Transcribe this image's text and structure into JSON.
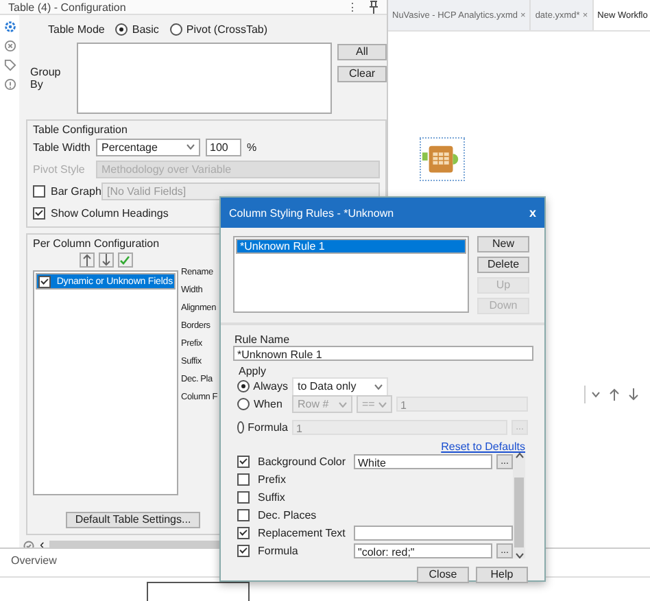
{
  "config_panel": {
    "title": "Table (4) - Configuration",
    "menu": "⋮",
    "table_mode": {
      "label": "Table Mode",
      "options": [
        {
          "label": "Basic",
          "selected": true
        },
        {
          "label": "Pivot (CrossTab)",
          "selected": false
        }
      ]
    },
    "group_by": {
      "label": "Group By",
      "buttons": [
        "All",
        "Clear"
      ]
    },
    "table_configuration": {
      "title": "Table Configuration",
      "table_width": {
        "label": "Table Width",
        "value": "Percentage",
        "number": "100",
        "unit": "%"
      },
      "pivot_style": {
        "label": "Pivot Style",
        "value": "Methodology over Variable",
        "disabled": true
      },
      "bar_graph": {
        "label": "Bar Graph",
        "checked": false,
        "value": "[No Valid Fields]"
      },
      "show_column_headings": {
        "label": "Show Column Headings",
        "checked": true
      }
    },
    "per_column": {
      "title": "Per Column Configuration",
      "fields": [
        {
          "label": "Dynamic or Unknown Fields",
          "checked": true,
          "selected": true
        }
      ],
      "properties": [
        "Rename",
        "Width",
        "Alignmen",
        "Borders",
        "Prefix",
        "Suffix",
        "Dec. Pla",
        "Column F"
      ]
    },
    "default_button": "Default Table Settings...",
    "scroll_left": "‹"
  },
  "overview": {
    "title": "Overview"
  },
  "tabs": [
    {
      "label": "NuVasive - HCP Analytics.yxmd",
      "close": "×",
      "selected": false
    },
    {
      "label": "date.yxmd*",
      "close": "×",
      "selected": false
    },
    {
      "label": "New Workflo",
      "selected": true
    }
  ],
  "dialog": {
    "title": "Column Styling Rules - *Unknown",
    "close": "x",
    "rules": [
      {
        "label": "*Unknown Rule 1",
        "selected": true
      }
    ],
    "rule_buttons": [
      {
        "label": "New",
        "disabled": false
      },
      {
        "label": "Delete",
        "disabled": false
      },
      {
        "label": "Up",
        "disabled": true
      },
      {
        "label": "Down",
        "disabled": true
      }
    ],
    "rule_name": {
      "label": "Rule Name",
      "value": "*Unknown Rule 1"
    },
    "apply": {
      "title": "Apply",
      "options": [
        {
          "label": "Always",
          "selected": true
        },
        {
          "label": "When",
          "selected": false
        },
        {
          "label": "Formula",
          "selected": false
        }
      ],
      "scope": "to Data only",
      "when_field": "Row #",
      "when_operator": "==",
      "when_value": "1",
      "formula_value": "1",
      "formula_button": "..."
    },
    "reset_link": "Reset to Defaults",
    "properties": [
      {
        "kind": "field_button",
        "label": "Background Color",
        "checked": true,
        "value": "White",
        "button": "..."
      },
      {
        "kind": "checkbox",
        "label": "Prefix",
        "checked": false
      },
      {
        "kind": "checkbox",
        "label": "Suffix",
        "checked": false
      },
      {
        "kind": "checkbox",
        "label": "Dec. Places",
        "checked": false
      },
      {
        "kind": "field",
        "label": "Replacement Text",
        "checked": true
      },
      {
        "kind": "field_button",
        "label": "Formula",
        "checked": true,
        "value": "\"color: red;\"",
        "button": "..."
      }
    ],
    "buttons": [
      "Close",
      "Help"
    ]
  }
}
